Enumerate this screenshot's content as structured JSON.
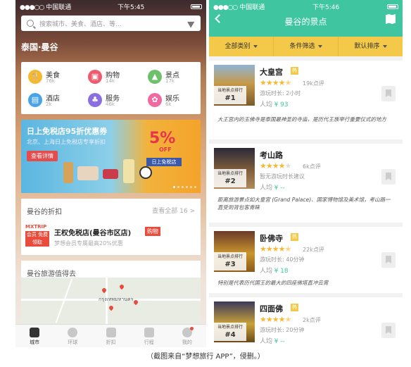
{
  "left": {
    "status": {
      "signal": "●●●○○",
      "carrier": "中国联通",
      "time": "下午5:45"
    },
    "search": {
      "placeholder": "搜索城市、美食、酒店、等..."
    },
    "city": "泰国·曼谷",
    "categories": [
      {
        "name": "美食",
        "count": "76k",
        "color": "#f5b82e",
        "icon": "food-icon"
      },
      {
        "name": "购物",
        "count": "14k",
        "color": "#ef5a6e",
        "icon": "shopping-bag-icon"
      },
      {
        "name": "景点",
        "count": "17k",
        "color": "#6cc16a",
        "icon": "landmark-icon"
      },
      {
        "name": "酒店",
        "count": "2k",
        "color": "#49a3e8",
        "icon": "hotel-icon"
      },
      {
        "name": "服务",
        "count": "46k",
        "color": "#8b6fe0",
        "icon": "service-icon"
      },
      {
        "name": "娱乐",
        "count": "6k",
        "color": "#ef6aa1",
        "icon": "entertainment-icon"
      }
    ],
    "banner": {
      "title": "日上免税店95折优惠券",
      "subtitle": "北京、上海日上免税店专享折扣",
      "button": "查看详情",
      "percent": "5%",
      "off": "OFF",
      "tag": "日上免税店"
    },
    "discount": {
      "header": "曼谷的折扣",
      "more": "查看全部 16 >",
      "logo_brand": "MXTRIP",
      "logo_lines": [
        "会员",
        "免费",
        "领取"
      ],
      "shop": "王权免税店(曼谷市区店)",
      "badge": "购物",
      "sub": "梦想会员专属最高20%优惠"
    },
    "worth": {
      "header": "曼谷旅游值得去",
      "map_label": "กรุงเทพมหานคร"
    },
    "tabs": [
      {
        "label": "城市",
        "active": true
      },
      {
        "label": "环球",
        "active": false
      },
      {
        "label": "折扣",
        "active": false
      },
      {
        "label": "行程",
        "active": false
      },
      {
        "label": "我的",
        "active": false
      }
    ]
  },
  "right": {
    "status": {
      "signal": "●●●○○",
      "carrier": "中国联通",
      "time": "下午5:46"
    },
    "title": "曼谷的景点",
    "filters": [
      "全部类别",
      "条件筛选",
      "默认排序"
    ],
    "places": [
      {
        "name": "大皇宫",
        "badge": "热",
        "rank_label": "当地景点排行",
        "rank": "#1",
        "rating": 4.5,
        "reviews": "19k点评",
        "duration": "游玩时长: 2小时",
        "price_label": "人均",
        "price": "¥ 93",
        "desc": "大王宫内的玉佛寺是泰国最神圣的寺庙，是历代王族举行重要仪式的地方"
      },
      {
        "name": "考山路",
        "badge": "",
        "rank_label": "当地景点排行",
        "rank": "#2",
        "rating": 4,
        "reviews": "6k点评",
        "duration": "暂无游玩时长建议",
        "price_label": "人均",
        "price": "¥ --",
        "desc": "距离旅游景点如大皇宫 (Grand Palace)、国家博物馆及美术馆，考山路一直受到背包客青睐"
      },
      {
        "name": "卧佛寺",
        "badge": "热",
        "rank_label": "当地景点排行",
        "rank": "#3",
        "rating": 4.5,
        "reviews": "22k点评",
        "duration": "游玩时长: 40分钟",
        "price_label": "人均",
        "price": "¥ 18",
        "desc": "特别是代表历代国王的最大的四座佛塔直冲云霄"
      },
      {
        "name": "四面佛",
        "badge": "热",
        "rank_label": "当地景点排行",
        "rank": "#4",
        "rating": 4.5,
        "reviews": "2k点评",
        "duration": "游玩时长: 20分钟",
        "price_label": "人均",
        "price": "¥ --",
        "desc": ""
      }
    ]
  },
  "caption": "（截图来自“梦想旅行 APP”，侵删。）"
}
